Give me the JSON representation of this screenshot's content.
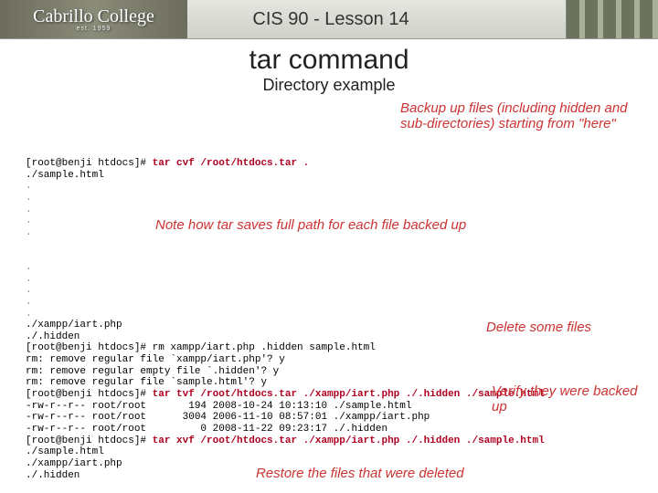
{
  "header": {
    "logo_main": "Cabrillo College",
    "logo_sub": "est. 1959",
    "lesson": "CIS 90 - Lesson 14"
  },
  "title": "tar command",
  "subtitle": "Directory example",
  "annotations": {
    "backup": "Backup up files (including hidden and sub-directories) starting from \"here\"",
    "fullpath": "Note how tar saves full path for each file backed up",
    "delete": "Delete some files",
    "verify": "Verify they were backed up",
    "restore": "Restore the files that were deleted"
  },
  "prompt": "[root@benji htdocs]# ",
  "cmds": {
    "cvf": "tar cvf /root/htdocs.tar .",
    "rm": "rm xampp/iart.php .hidden sample.html",
    "tvf": "tar tvf /root/htdocs.tar ./xampp/iart.php ./.hidden ./sample.html",
    "xvf": "tar xvf /root/htdocs.tar ./xampp/iart.php ./.hidden ./sample.html"
  },
  "out": {
    "sample": "./sample.html",
    "iart": "./xampp/iart.php",
    "hidden": "./.hidden",
    "rm1": "rm: remove regular file `xampp/iart.php'? y",
    "rm2": "rm: remove regular empty file `.hidden'? y",
    "rm3": "rm: remove regular file `sample.html'? y",
    "ls1": "-rw-r--r-- root/root       194 2008-10-24 10:13:10 ./sample.html",
    "ls2": "-rw-r--r-- root/root      3004 2006-11-10 08:57:01 ./xampp/iart.php",
    "ls3": "-rw-r--r-- root/root         0 2008-11-22 09:23:17 ./.hidden"
  }
}
